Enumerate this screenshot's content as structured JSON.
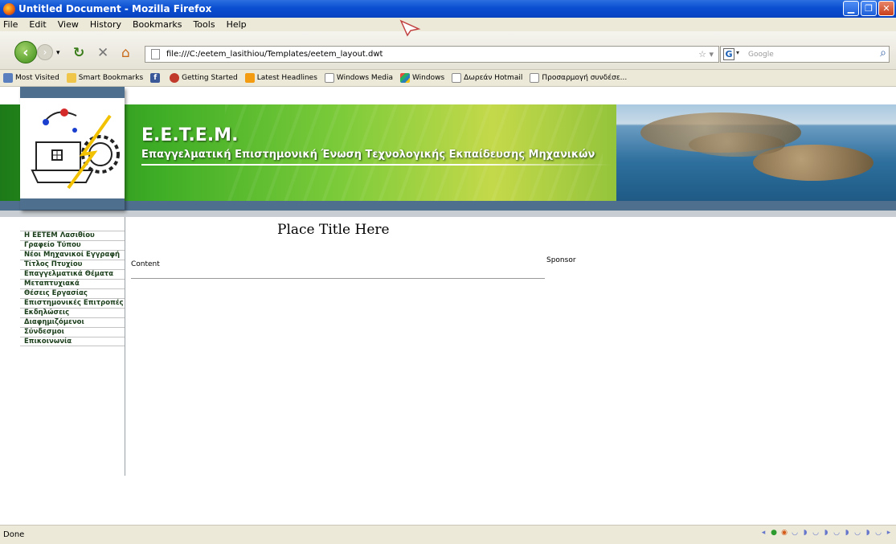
{
  "window": {
    "title": "Untitled Document - Mozilla Firefox"
  },
  "menu": [
    "File",
    "Edit",
    "View",
    "History",
    "Bookmarks",
    "Tools",
    "Help"
  ],
  "address": {
    "url": "file:///C:/eetem_lasithiou/Templates/eetem_layout.dwt"
  },
  "search": {
    "placeholder": "Google"
  },
  "bookmarks": [
    "Most Visited",
    "Smart Bookmarks",
    "Getting Started",
    "Latest Headlines",
    "Windows Media",
    "Windows",
    "Δωρεάν Hotmail",
    "Προσαρμογή συνδέσε..."
  ],
  "header": {
    "org_title": "E.E.T.E.M.",
    "org_subtitle": "Επαγγελματική Επιστημονική Ένωση Τεχνολογικής Εκπαίδευσης Μηχανικών"
  },
  "sidebar": {
    "items": [
      "Η ΕΕΤΕΜ Λασιθίου",
      "Γραφείο Τύπου",
      "Νέοι Μηχανικοί Εγγραφή",
      "Τίτλος Πτυχίου",
      "Επαγγελματικά Θέματα",
      "Μεταπτυχιακά",
      "Θέσεις Εργασίας",
      "Επιστημονικές Επιτροπές",
      "Εκδηλώσεις",
      "Διαφημιζόμενοι",
      "Σύνδεσμοι",
      "Επικοινωνία"
    ]
  },
  "main": {
    "title": "Place Title Here",
    "content": "Content",
    "sponsor": "Sponsor"
  },
  "status": {
    "text": "Done"
  }
}
